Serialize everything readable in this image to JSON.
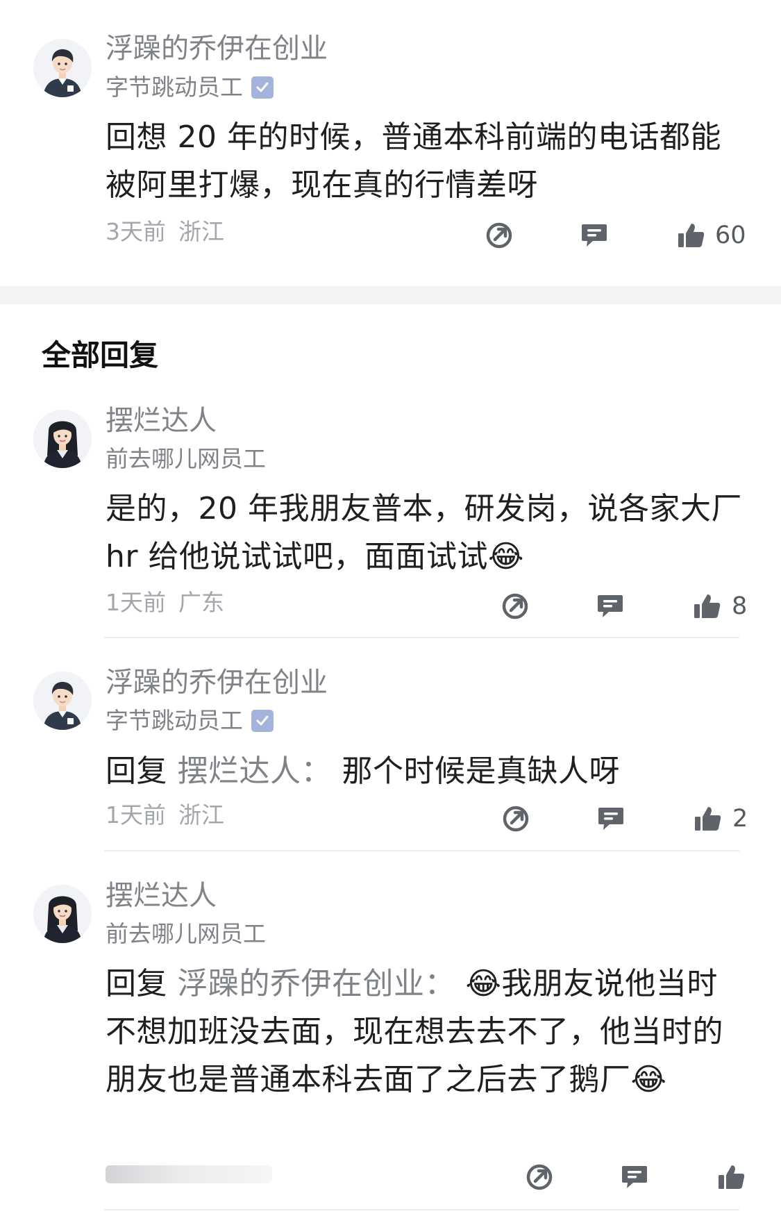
{
  "main_comment": {
    "author": "浮躁的乔伊在创业",
    "title": "字节跳动员工",
    "verified": true,
    "content": "回想 20 年的时候，普通本科前端的电话都能被阿里打爆，现在真的行情差呀",
    "time": "3天前",
    "location": "浙江",
    "likes": "60"
  },
  "section": {
    "title": "全部回复"
  },
  "replies": [
    {
      "author": "摆烂达人",
      "title": "前去哪儿网员工",
      "content": "是的，20 年我朋友普本，研发岗，说各家大厂 hr 给他说试试吧，面面试试😂",
      "time": "1天前",
      "location": "广东",
      "likes": "8"
    },
    {
      "author": "浮躁的乔伊在创业",
      "title": "字节跳动员工",
      "verified": true,
      "reply_prefix": "回复",
      "reply_target": "摆烂达人：",
      "content": "那个时候是真缺人呀",
      "time": "1天前",
      "location": "浙江",
      "likes": "2"
    },
    {
      "author": "摆烂达人",
      "title": "前去哪儿网员工",
      "reply_prefix": "回复",
      "reply_target": "浮躁的乔伊在创业：",
      "content": "😂我朋友说他当时不想加班没去面，现在想去去不了，他当时的朋友也是普通本科去面了之后去了鹅厂😂"
    }
  ],
  "icons": {
    "share": "share-icon",
    "comment": "comment-icon",
    "like": "thumbs-up-icon",
    "verified": "verified-badge-icon"
  },
  "colors": {
    "meta_gray": "#a3a7ad",
    "name_gray": "#7f8389",
    "action_gray": "#5f646b",
    "badge_blue": "#a4b3dc",
    "separator": "#f2f3f5"
  }
}
